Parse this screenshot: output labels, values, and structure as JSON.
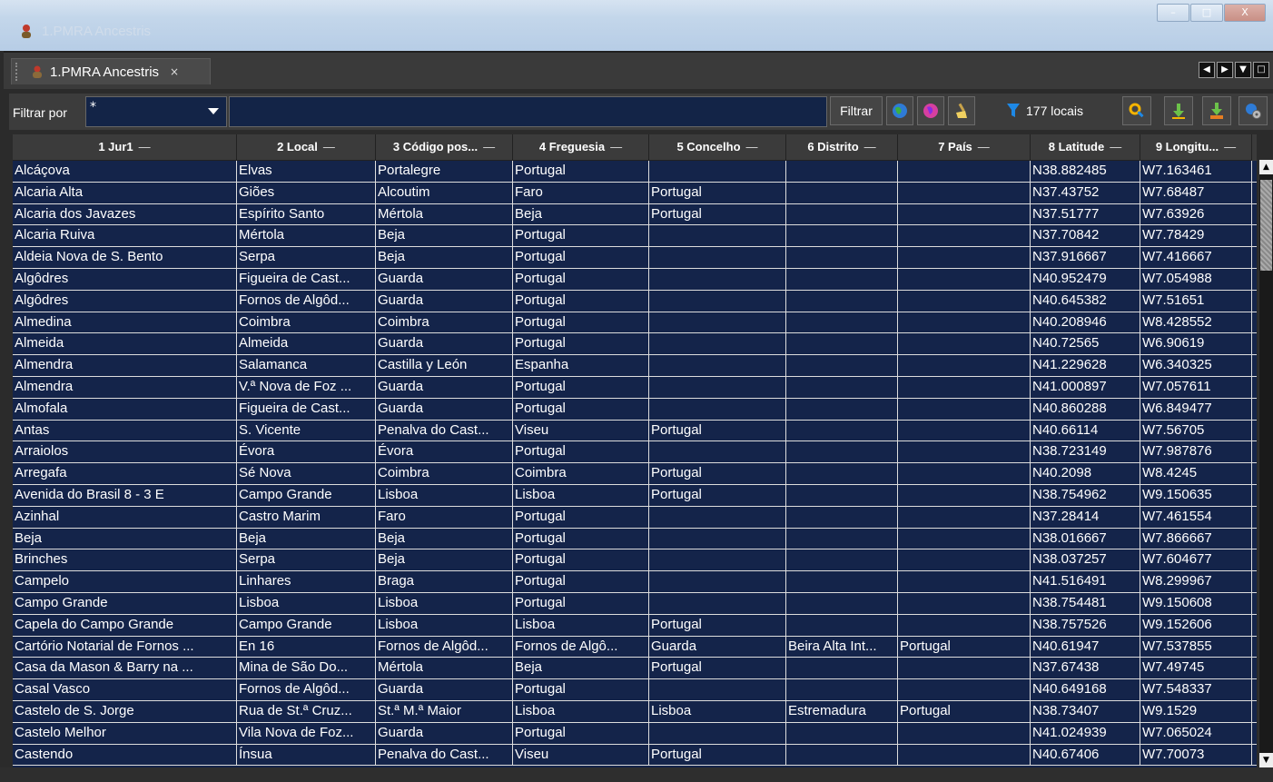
{
  "window": {
    "title": "1.PMRA Ancestris",
    "minimize": "–",
    "maximize": "□",
    "close": "X"
  },
  "tab": {
    "label": "1.PMRA Ancestris",
    "close": "×"
  },
  "toolbar": {
    "filter_label": "Filtrar por",
    "filter_value": "*",
    "filter_input_value": "",
    "filter_button": "Filtrar",
    "count_text": "177 locais"
  },
  "table": {
    "columns": [
      {
        "label": "1 Jur1",
        "sort": "—"
      },
      {
        "label": "2 Local",
        "sort": "—"
      },
      {
        "label": "3 Código pos...",
        "sort": "—"
      },
      {
        "label": "4 Freguesia",
        "sort": "—"
      },
      {
        "label": "5 Concelho",
        "sort": "—"
      },
      {
        "label": "6 Distrito",
        "sort": "—"
      },
      {
        "label": "7 País",
        "sort": "—"
      },
      {
        "label": "8 Latitude",
        "sort": "—"
      },
      {
        "label": "9 Longitu...",
        "sort": "—"
      }
    ],
    "rows": [
      [
        "Alcáçova",
        "Elvas",
        "Portalegre",
        "Portugal",
        "",
        "",
        "",
        "N38.882485",
        "W7.163461"
      ],
      [
        "Alcaria Alta",
        "Giões",
        "Alcoutim",
        "Faro",
        "Portugal",
        "",
        "",
        "N37.43752",
        "W7.68487"
      ],
      [
        "Alcaria dos Javazes",
        "Espírito Santo",
        "Mértola",
        "Beja",
        "Portugal",
        "",
        "",
        "N37.51777",
        "W7.63926"
      ],
      [
        "Alcaria Ruiva",
        "Mértola",
        "Beja",
        "Portugal",
        "",
        "",
        "",
        "N37.70842",
        "W7.78429"
      ],
      [
        "Aldeia Nova de S. Bento",
        "Serpa",
        "Beja",
        "Portugal",
        "",
        "",
        "",
        "N37.916667",
        "W7.416667"
      ],
      [
        "Algôdres",
        "Figueira de Cast...",
        "Guarda",
        "Portugal",
        "",
        "",
        "",
        "N40.952479",
        "W7.054988"
      ],
      [
        "Algôdres",
        "Fornos de Algôd...",
        "Guarda",
        "Portugal",
        "",
        "",
        "",
        "N40.645382",
        "W7.51651"
      ],
      [
        "Almedina",
        "Coimbra",
        "Coimbra",
        "Portugal",
        "",
        "",
        "",
        "N40.208946",
        "W8.428552"
      ],
      [
        "Almeida",
        "Almeida",
        "Guarda",
        "Portugal",
        "",
        "",
        "",
        "N40.72565",
        "W6.90619"
      ],
      [
        "Almendra",
        "Salamanca",
        "Castilla y León",
        "Espanha",
        "",
        "",
        "",
        "N41.229628",
        "W6.340325"
      ],
      [
        "Almendra",
        "V.ª Nova de Foz ...",
        "Guarda",
        "Portugal",
        "",
        "",
        "",
        "N41.000897",
        "W7.057611"
      ],
      [
        "Almofala",
        "Figueira de Cast...",
        "Guarda",
        "Portugal",
        "",
        "",
        "",
        "N40.860288",
        "W6.849477"
      ],
      [
        "Antas",
        "S. Vicente",
        "Penalva do Cast...",
        "Viseu",
        "Portugal",
        "",
        "",
        "N40.66114",
        "W7.56705"
      ],
      [
        "Arraiolos",
        "Évora",
        "Évora",
        "Portugal",
        "",
        "",
        "",
        "N38.723149",
        "W7.987876"
      ],
      [
        "Arregafa",
        "Sé Nova",
        "Coimbra",
        "Coimbra",
        "Portugal",
        "",
        "",
        "N40.2098",
        "W8.4245"
      ],
      [
        "Avenida do Brasil 8 - 3 E",
        "Campo Grande",
        "Lisboa",
        "Lisboa",
        "Portugal",
        "",
        "",
        "N38.754962",
        "W9.150635"
      ],
      [
        "Azinhal",
        "Castro Marim",
        "Faro",
        "Portugal",
        "",
        "",
        "",
        "N37.28414",
        "W7.461554"
      ],
      [
        "Beja",
        "Beja",
        "Beja",
        "Portugal",
        "",
        "",
        "",
        "N38.016667",
        "W7.866667"
      ],
      [
        "Brinches",
        "Serpa",
        "Beja",
        "Portugal",
        "",
        "",
        "",
        "N38.037257",
        "W7.604677"
      ],
      [
        "Campelo",
        "Linhares",
        "Braga",
        "Portugal",
        "",
        "",
        "",
        "N41.516491",
        "W8.299967"
      ],
      [
        "Campo Grande",
        "Lisboa",
        "Lisboa",
        "Portugal",
        "",
        "",
        "",
        "N38.754481",
        "W9.150608"
      ],
      [
        "Capela do Campo Grande",
        "Campo Grande",
        "Lisboa",
        "Lisboa",
        "Portugal",
        "",
        "",
        "N38.757526",
        "W9.152606"
      ],
      [
        "Cartório Notarial de Fornos ...",
        "En 16",
        "Fornos de Algôd...",
        "Fornos de Algô...",
        "Guarda",
        "Beira Alta Int...",
        "Portugal",
        "N40.61947",
        "W7.537855"
      ],
      [
        "Casa da Mason & Barry na ...",
        "Mina de São Do...",
        "Mértola",
        "Beja",
        "Portugal",
        "",
        "",
        "N37.67438",
        "W7.49745"
      ],
      [
        "Casal Vasco",
        "Fornos de Algôd...",
        "Guarda",
        "Portugal",
        "",
        "",
        "",
        "N40.649168",
        "W7.548337"
      ],
      [
        "Castelo de S. Jorge",
        "Rua de St.ª Cruz...",
        "St.ª M.ª Maior",
        "Lisboa",
        "Lisboa",
        "Estremadura",
        "Portugal",
        "N38.73407",
        "W9.1529"
      ],
      [
        "Castelo Melhor",
        "Vila Nova de Foz...",
        "Guarda",
        "Portugal",
        "",
        "",
        "",
        "N41.024939",
        "W7.065024"
      ],
      [
        "Castendo",
        "Ínsua",
        "Penalva do Cast...",
        "Viseu",
        "Portugal",
        "",
        "",
        "N40.67406",
        "W7.70073"
      ]
    ]
  },
  "colors": {
    "grid_bg": "#14244a",
    "header_bg": "#3b3b3b",
    "toolbar_bg": "#3c3c3c"
  }
}
